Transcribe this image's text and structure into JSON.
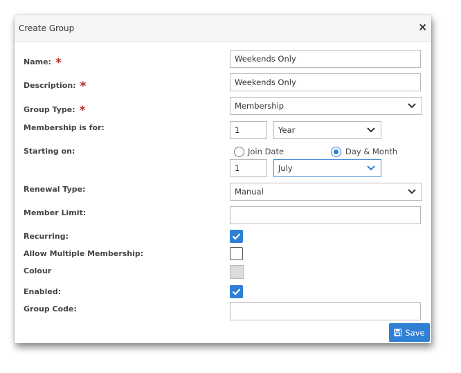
{
  "dialog": {
    "title": "Create Group",
    "close_glyph": "×",
    "save_label": "Save"
  },
  "required_marker": "*",
  "fields": {
    "name": {
      "label": "Name:",
      "value": "Weekends Only",
      "required": true
    },
    "description": {
      "label": "Description:",
      "value": "Weekends Only",
      "required": true
    },
    "group_type": {
      "label": "Group Type:",
      "selected": "Membership",
      "required": true
    },
    "membership_for": {
      "label": "Membership is for:",
      "amount": "1",
      "unit": "Year"
    },
    "starting_on": {
      "label": "Starting on:",
      "options": [
        "Join Date",
        "Day & Month"
      ],
      "selected_option": "Day & Month",
      "day": "1",
      "month": "July"
    },
    "renewal_type": {
      "label": "Renewal Type:",
      "selected": "Manual"
    },
    "member_limit": {
      "label": "Member Limit:",
      "value": ""
    },
    "recurring": {
      "label": "Recurring:",
      "checked": true
    },
    "allow_multiple": {
      "label": "Allow Multiple Membership:",
      "checked": false
    },
    "colour": {
      "label": "Colour",
      "value": "#dcdcdc"
    },
    "enabled": {
      "label": "Enabled:",
      "checked": true
    },
    "group_code": {
      "label": "Group Code:",
      "value": ""
    }
  },
  "icons": {
    "close": "close-icon",
    "dropdown": "chevron-down-icon",
    "check": "checkmark-icon",
    "save": "floppy-disk-icon"
  },
  "colors": {
    "accent": "#2f7fd4",
    "required": "#b32d2d",
    "header_bg": "#f5f5f5"
  }
}
